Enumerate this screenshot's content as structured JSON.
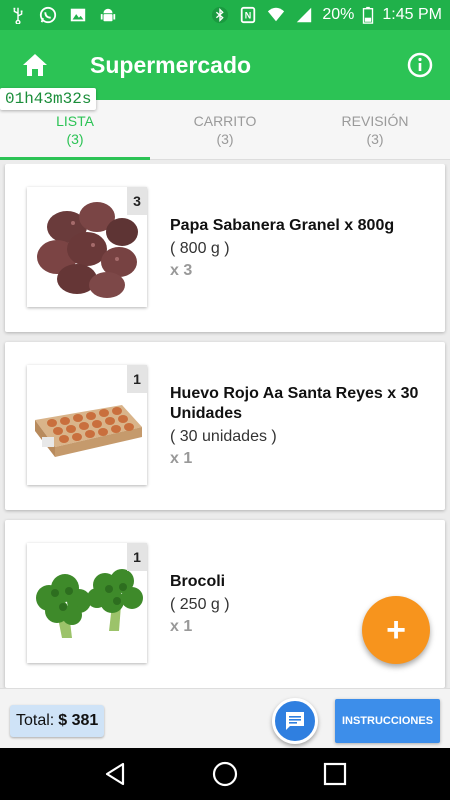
{
  "status_bar": {
    "left_icons": [
      "usb-icon",
      "whatsapp-icon",
      "image-icon",
      "android-debug-icon"
    ],
    "right_icons": [
      "bluetooth-icon",
      "nfc-icon",
      "wifi-icon",
      "signal-icon",
      "battery-icon"
    ],
    "battery": "20%",
    "time": "1:45 PM"
  },
  "app_bar": {
    "title": "Supermercado",
    "home_icon": "home-icon",
    "info_icon": "info-icon"
  },
  "timer": "01h43m32s",
  "tabs": [
    {
      "label": "LISTA",
      "count": "(3)",
      "active": true
    },
    {
      "label": "CARRITO",
      "count": "(3)",
      "active": false
    },
    {
      "label": "REVISIÓN",
      "count": "(3)",
      "active": false
    }
  ],
  "products": [
    {
      "name": "Papa Sabanera Granel x 800g",
      "size": "( 800 g )",
      "qty": "x 3",
      "badge": "3"
    },
    {
      "name": "Huevo Rojo Aa Santa Reyes x 30 Unidades",
      "size": "( 30 unidades )",
      "qty": "x 1",
      "badge": "1"
    },
    {
      "name": "Brocoli",
      "size": "( 250 g )",
      "qty": "x 1",
      "badge": "1"
    }
  ],
  "fab_label": "+",
  "bottom_bar": {
    "total_label": "Total:",
    "total_value": "$ 381",
    "instructions_label": "INSTRUCCIONES"
  },
  "colors": {
    "status_bar": "#20b14a",
    "app_bar": "#2cc355",
    "accent": "#2cc355",
    "fab": "#f7941d",
    "button_blue": "#3d8eea"
  }
}
